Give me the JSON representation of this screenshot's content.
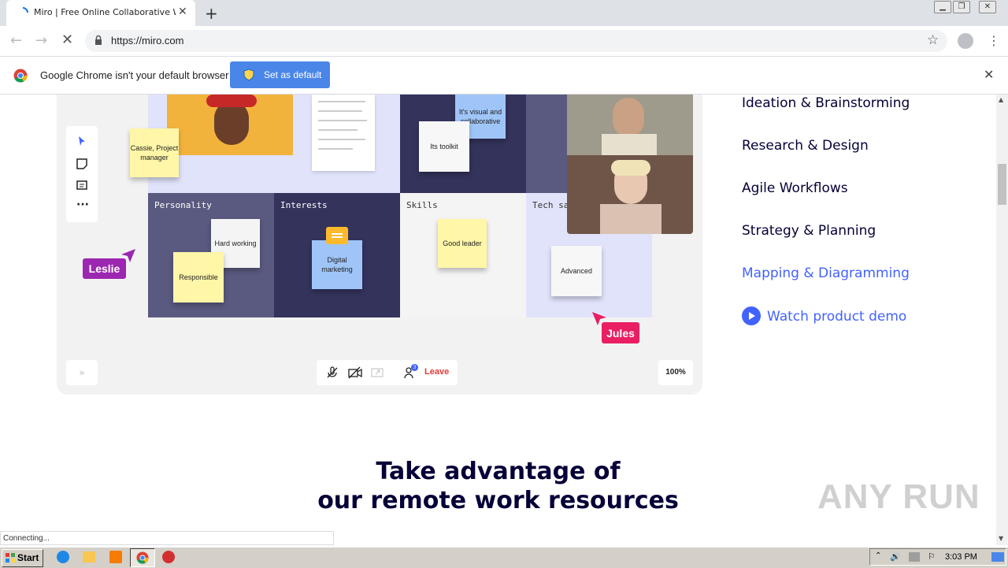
{
  "browser": {
    "tab_title": "Miro | Free Online Collaborative Whi",
    "new_tab": "+",
    "url": "https://miro.com"
  },
  "infobar": {
    "message": "Google Chrome isn't your default browser",
    "button_label": "Set as default"
  },
  "board": {
    "top_stickies": [
      "Cassie, Project manager",
      "It's visual and collaborative",
      "Its toolkit"
    ],
    "categories": [
      {
        "label": "Personality",
        "stickies": [
          "Hard working",
          "Responsible"
        ]
      },
      {
        "label": "Interests",
        "stickies": [
          "Digital marketing"
        ]
      },
      {
        "label": "Skills",
        "stickies": [
          "Good leader"
        ]
      },
      {
        "label": "Tech sav",
        "stickies": [
          "Advanced"
        ]
      }
    ],
    "cursors": [
      {
        "name": "Leslie",
        "color": "#9c27b0"
      },
      {
        "name": "Jules",
        "color": "#e91e63"
      }
    ],
    "call_controls": {
      "leave_label": "Leave",
      "participant_count": "3"
    },
    "zoom": "100%",
    "collapse_label": "»"
  },
  "menu": {
    "items": [
      "Ideation & Brainstorming",
      "Research & Design",
      "Agile Workflows",
      "Strategy & Planning",
      "Mapping & Diagramming"
    ],
    "active_color": "#4262ff",
    "demo_link": "Watch product demo"
  },
  "headline": {
    "line1": "Take advantage of",
    "line2": "our remote work resources"
  },
  "status": "Connecting...",
  "taskbar": {
    "start": "Start",
    "clock": "3:03 PM"
  },
  "watermark": "ANY RUN"
}
